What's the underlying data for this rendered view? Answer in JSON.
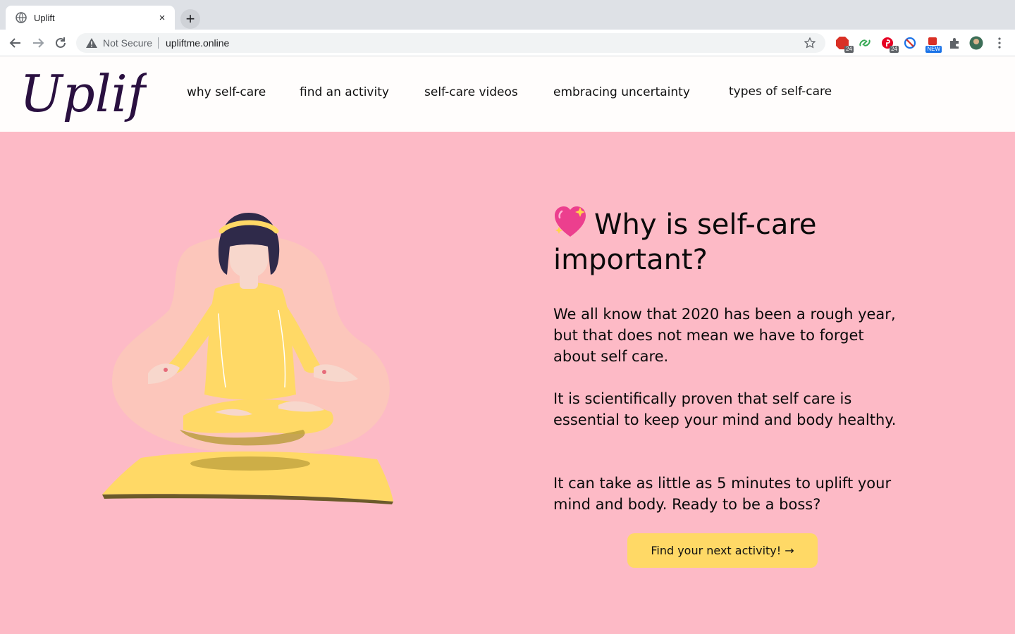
{
  "browser": {
    "tab_title": "Uplift",
    "tab_close": "×",
    "new_tab": "+",
    "security_label": "Not Secure",
    "url": "upliftme.online",
    "extensions": [
      {
        "name": "adblock-extension",
        "badge": "24",
        "color": "#d93025"
      },
      {
        "name": "link-extension",
        "badge": "",
        "color": "#34a853"
      },
      {
        "name": "pinterest-extension",
        "badge": "24",
        "color": "#e60023"
      },
      {
        "name": "block-extension",
        "badge": "",
        "color": "#1a73e8"
      },
      {
        "name": "new-extension",
        "badge": "NEW",
        "color": "#1a73e8"
      }
    ]
  },
  "site": {
    "logo_text": "Uplift",
    "nav": [
      {
        "label": "why self-care"
      },
      {
        "label": "find an activity"
      },
      {
        "label": "self-care videos"
      },
      {
        "label": "embracing uncertainty"
      },
      {
        "label": "types of self-care"
      }
    ]
  },
  "hero": {
    "heading": "Why is self-care important?",
    "paragraphs": [
      "We all know that 2020 has been a rough year, but that does not mean we have to forget about self care.",
      "It is scientifically proven that self care is essential to keep your mind and body healthy.",
      "It can take as little as 5 minutes to uplift your mind and body. Ready to be a boss?"
    ],
    "cta_label": "Find your next activity! →"
  },
  "colors": {
    "page_bg": "#fdbac6",
    "header_bg": "#fffdfc",
    "logo": "#2a1040",
    "cta_bg": "#ffd966"
  }
}
